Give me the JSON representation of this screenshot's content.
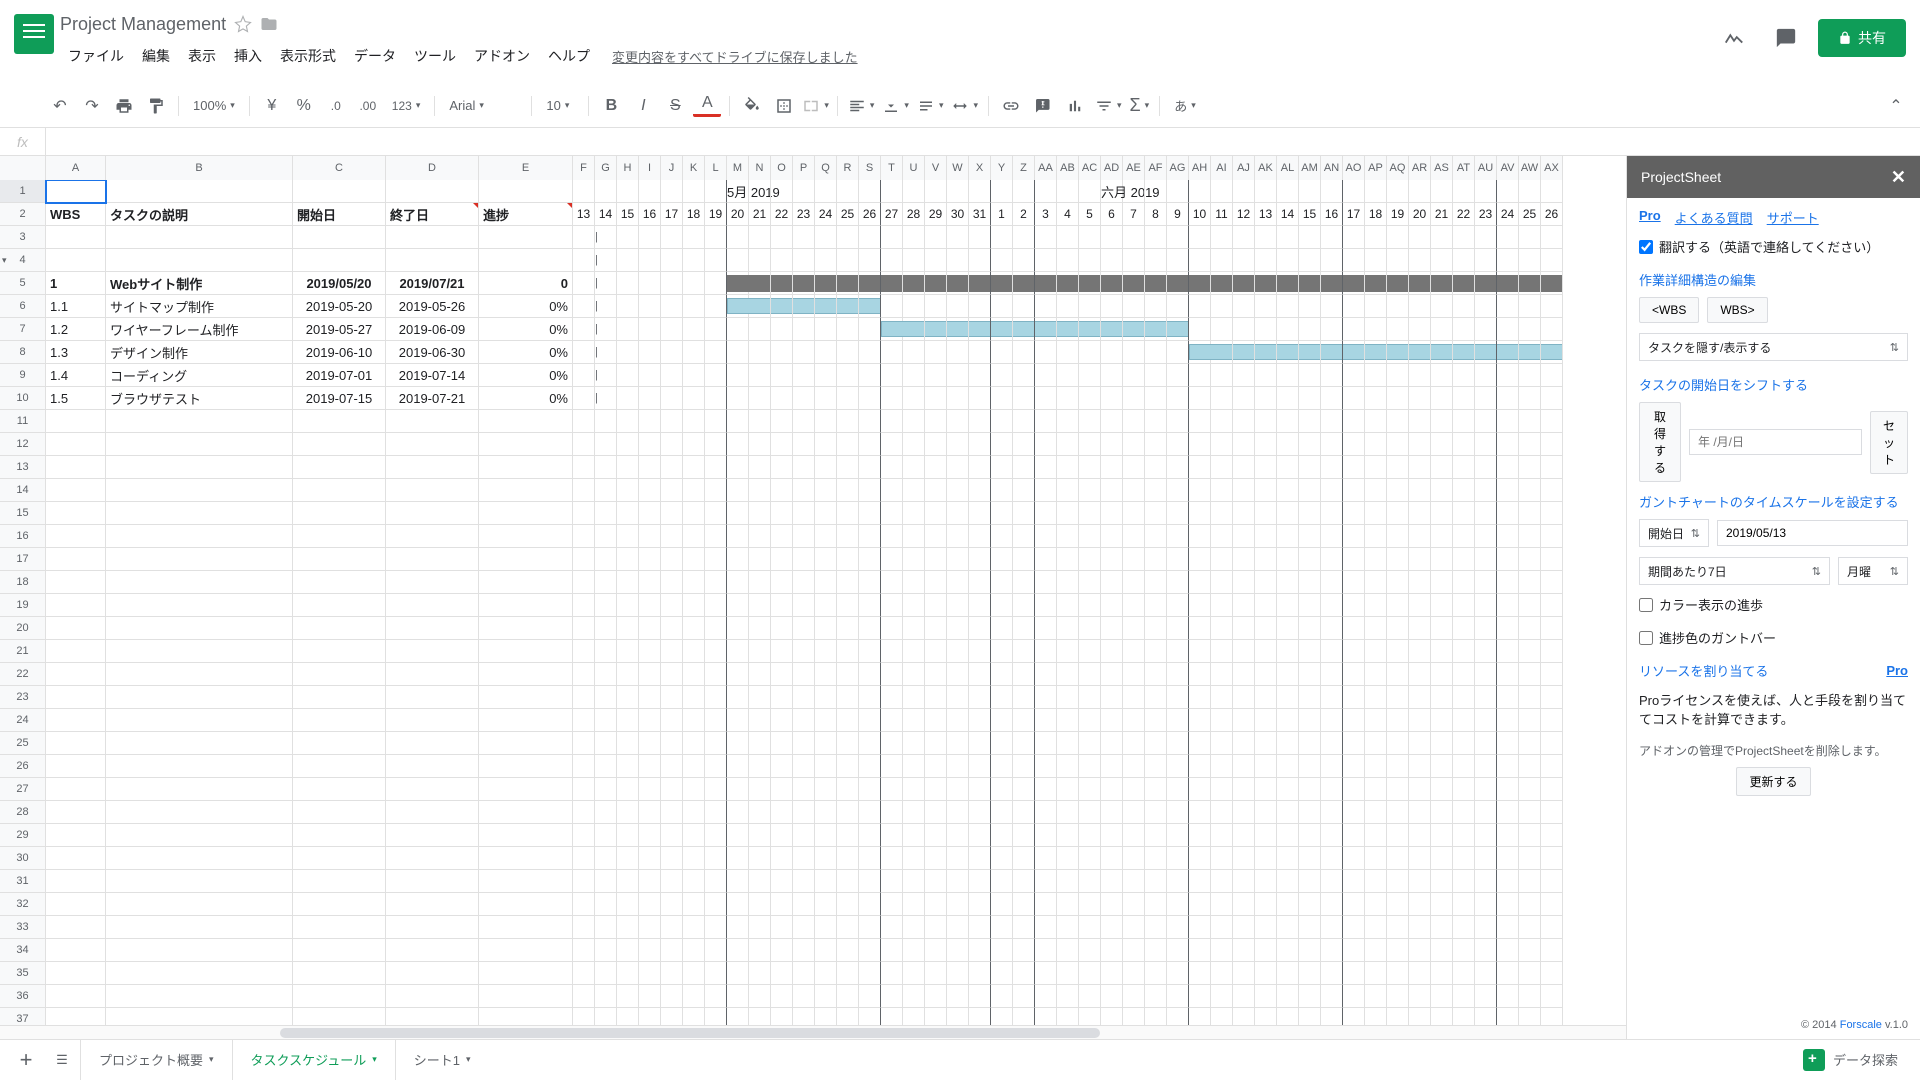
{
  "doc_title": "Project Management",
  "menus": [
    "ファイル",
    "編集",
    "表示",
    "挿入",
    "表示形式",
    "データ",
    "ツール",
    "アドオン",
    "ヘルプ"
  ],
  "save_msg": "変更内容をすべてドライブに保存しました",
  "share_label": "共有",
  "zoom": "100%",
  "font": "Arial",
  "font_size": "10",
  "col_widths": {
    "A": 60,
    "B": 187,
    "C": 93,
    "D": 93,
    "E": 94,
    "gantt": 22
  },
  "col_letters": [
    "A",
    "B",
    "C",
    "D",
    "E",
    "F",
    "G",
    "H",
    "I",
    "J",
    "K",
    "L",
    "M",
    "N",
    "O",
    "P",
    "Q",
    "R",
    "S",
    "T",
    "U",
    "V",
    "W",
    "X",
    "Y",
    "Z",
    "AA",
    "AB",
    "AC",
    "AD",
    "AE",
    "AF",
    "AG",
    "AH",
    "AI",
    "AJ",
    "AK",
    "AL",
    "AM",
    "AN",
    "AO",
    "AP",
    "AQ",
    "AR",
    "AS",
    "AT",
    "AU",
    "AV",
    "AW",
    "AX"
  ],
  "headers": {
    "wbs": "WBS",
    "desc": "タスクの説明",
    "start": "開始日",
    "end": "終了日",
    "prog": "進捗"
  },
  "months": {
    "may": "5月 2019",
    "jun": "六月 2019"
  },
  "days": [
    "13",
    "14",
    "15",
    "16",
    "17",
    "18",
    "19",
    "20",
    "21",
    "22",
    "23",
    "24",
    "25",
    "26",
    "27",
    "28",
    "29",
    "30",
    "31",
    "1",
    "2",
    "3",
    "4",
    "5",
    "6",
    "7",
    "8",
    "9",
    "10",
    "11",
    "12",
    "13",
    "14",
    "15",
    "16",
    "17",
    "18",
    "19",
    "20",
    "21",
    "22",
    "23",
    "24",
    "25",
    "26"
  ],
  "rows": [
    {
      "r": 5,
      "wbs": "1",
      "desc": "Webサイト制作",
      "start": "2019/05/20",
      "end": "2019/07/21",
      "prog": "0",
      "bold": true,
      "bar": {
        "from": 7,
        "to": 62,
        "color": "gray"
      }
    },
    {
      "r": 6,
      "wbs": "1.1",
      "desc": "サイトマップ制作",
      "start": "2019-05-20",
      "end": "2019-05-26",
      "prog": "0%",
      "bar": {
        "from": 7,
        "to": 13,
        "color": "blue"
      }
    },
    {
      "r": 7,
      "wbs": "1.2",
      "desc": "ワイヤーフレーム制作",
      "start": "2019-05-27",
      "end": "2019-06-09",
      "prog": "0%",
      "bar": {
        "from": 14,
        "to": 27,
        "color": "blue"
      }
    },
    {
      "r": 8,
      "wbs": "1.3",
      "desc": "デザイン制作",
      "start": "2019-06-10",
      "end": "2019-06-30",
      "prog": "0%",
      "bar": {
        "from": 28,
        "to": 48,
        "color": "blue"
      }
    },
    {
      "r": 9,
      "wbs": "1.4",
      "desc": "コーディング",
      "start": "2019-07-01",
      "end": "2019-07-14",
      "prog": "0%"
    },
    {
      "r": 10,
      "wbs": "1.5",
      "desc": "ブラウザテスト",
      "start": "2019-07-15",
      "end": "2019-07-21",
      "prog": "0%"
    }
  ],
  "sheet_tabs": [
    {
      "label": "プロジェクト概要",
      "active": false
    },
    {
      "label": "タスクスケジュール",
      "active": true
    },
    {
      "label": "シート1",
      "active": false
    }
  ],
  "explore_label": "データ探索",
  "sidebar": {
    "title": "ProjectSheet",
    "links": {
      "pro": "Pro",
      "faq": "よくある質問",
      "support": "サポート"
    },
    "translate_label": "翻訳する（英語で連絡してください）",
    "section_wbs": "作業詳細構造の編集",
    "wbs_back": "<WBS",
    "wbs_fwd": "WBS>",
    "hide_show": "タスクを隠す/表示する",
    "section_shift": "タスクの開始日をシフトする",
    "get_btn": "取得する",
    "date_ph": "年 /月/日",
    "set_btn": "セット",
    "section_timescale": "ガントチャートのタイムスケールを設定する",
    "start_sel": "開始日",
    "start_date": "2019/05/13",
    "period": "期間あたり7日",
    "weekday": "月曜",
    "color_progress": "カラー表示の進歩",
    "progress_bar": "進捗色のガントバー",
    "section_resource": "リソースを割り当てる",
    "pro_link": "Pro",
    "pro_desc": "Proライセンスを使えば、人と手段を割り当ててコストを計算できます。",
    "manage_note": "アドオンの管理でProjectSheetを削除します。",
    "update_btn": "更新する",
    "copyright": "© 2014 ",
    "forscale": "Forscale",
    "version": " v.1.0"
  }
}
